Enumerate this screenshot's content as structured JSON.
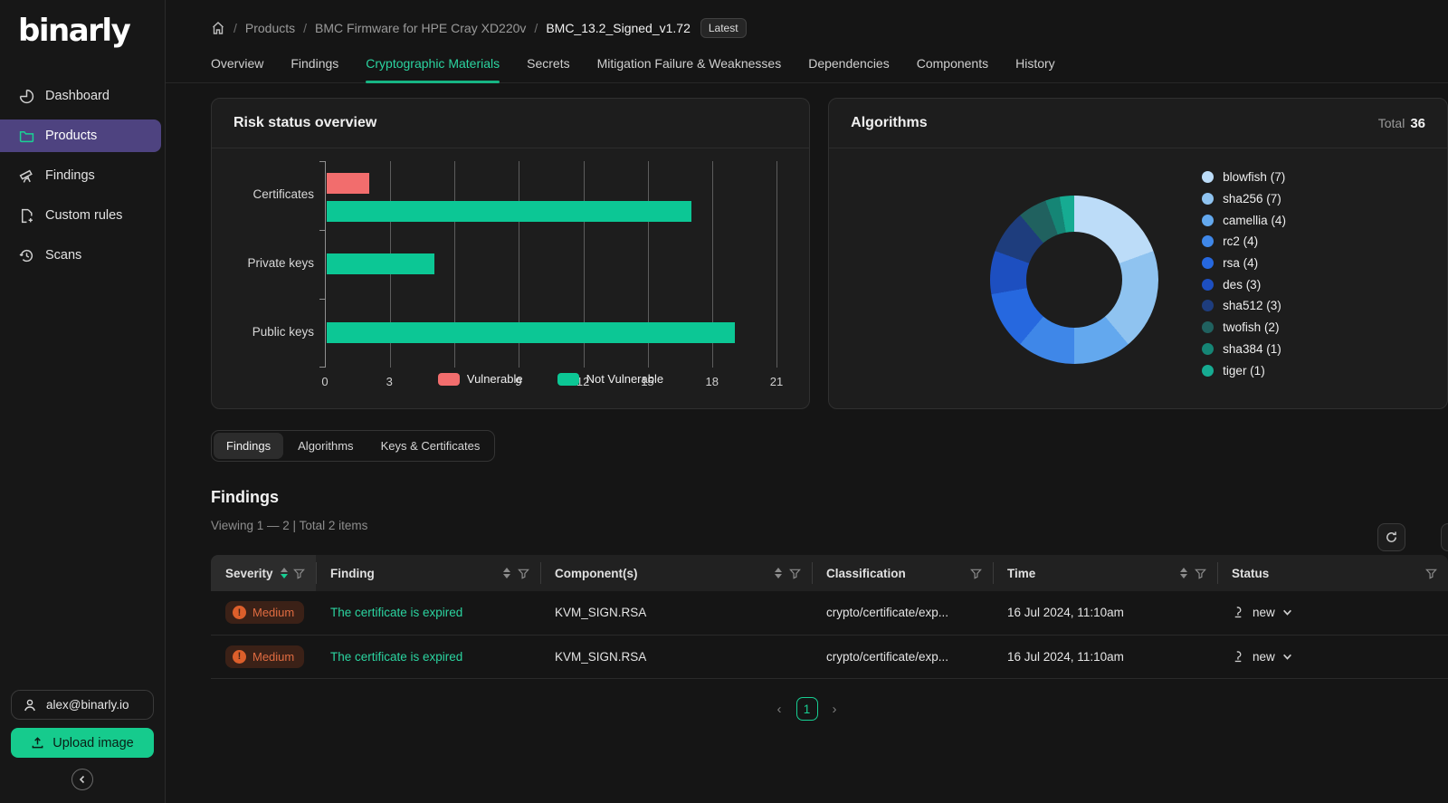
{
  "ui": {
    "logo": "binarly",
    "breadcrumb": {
      "items": [
        "Products",
        "BMC Firmware for HPE Cray XD220v",
        "BMC_13.2_Signed_v1.72"
      ],
      "badge": "Latest"
    },
    "tabs": [
      {
        "label": "Overview"
      },
      {
        "label": "Findings"
      },
      {
        "label": "Cryptographic Materials"
      },
      {
        "label": "Secrets"
      },
      {
        "label": "Mitigation Failure & Weaknesses"
      },
      {
        "label": "Dependencies"
      },
      {
        "label": "Components"
      },
      {
        "label": "History"
      }
    ],
    "subtabs": [
      {
        "label": "Findings"
      },
      {
        "label": "Algorithms"
      },
      {
        "label": "Keys & Certificates"
      }
    ],
    "algorithms_total_label": "Total",
    "algorithms_total_value": "36",
    "findings_title": "Findings",
    "findings_viewing": "Viewing 1 — 2 | Total 2 items",
    "pagination": {
      "page": "1"
    }
  },
  "sidebar": {
    "items": [
      {
        "label": "Dashboard"
      },
      {
        "label": "Products"
      },
      {
        "label": "Findings"
      },
      {
        "label": "Custom rules"
      },
      {
        "label": "Scans"
      }
    ],
    "account": "alex@binarly.io",
    "upload": "Upload image"
  },
  "table": {
    "columns": [
      {
        "label": "Severity"
      },
      {
        "label": "Finding"
      },
      {
        "label": "Component(s)"
      },
      {
        "label": "Classification"
      },
      {
        "label": "Time"
      },
      {
        "label": "Status"
      }
    ],
    "rows": [
      {
        "severity": "Medium",
        "finding": "The certificate is expired",
        "component": "KVM_SIGN.RSA",
        "classification": "crypto/certificate/exp...",
        "time": "16 Jul 2024, 11:10am",
        "status": "new"
      },
      {
        "severity": "Medium",
        "finding": "The certificate is expired",
        "component": "KVM_SIGN.RSA",
        "classification": "crypto/certificate/exp...",
        "time": "16 Jul 2024, 11:10am",
        "status": "new"
      }
    ]
  },
  "chart_data": [
    {
      "type": "bar",
      "orientation": "horizontal",
      "title": "Risk status overview",
      "categories": [
        "Certificates",
        "Private keys",
        "Public keys"
      ],
      "series": [
        {
          "name": "Vulnerable",
          "color": "#f26d6d",
          "values": [
            2,
            0,
            0
          ]
        },
        {
          "name": "Not Vulnerable",
          "color": "#0cc795",
          "values": [
            17,
            5,
            19
          ]
        }
      ],
      "xlim": [
        0,
        21
      ],
      "ticks": [
        0,
        3,
        6,
        9,
        12,
        15,
        18,
        21
      ],
      "grid": true,
      "legend_position": "bottom"
    },
    {
      "type": "pie",
      "subtype": "donut",
      "title": "Algorithms",
      "total": 36,
      "legend_position": "right",
      "slices": [
        {
          "label": "blowfish",
          "value": 7,
          "display": "blowfish (7)",
          "color": "#bcdcf8"
        },
        {
          "label": "sha256",
          "value": 7,
          "display": "sha256 (7)",
          "color": "#8fc3f0"
        },
        {
          "label": "camellia",
          "value": 4,
          "display": "camellia (4)",
          "color": "#63a8ee"
        },
        {
          "label": "rc2",
          "value": 4,
          "display": "rc2 (4)",
          "color": "#3f87e8"
        },
        {
          "label": "rsa",
          "value": 4,
          "display": "rsa (4)",
          "color": "#2668df"
        },
        {
          "label": "des",
          "value": 3,
          "display": "des (3)",
          "color": "#1d4fc0"
        },
        {
          "label": "sha512",
          "value": 3,
          "display": "sha512 (3)",
          "color": "#1e3d7d"
        },
        {
          "label": "twofish",
          "value": 2,
          "display": "twofish (2)",
          "color": "#20615f"
        },
        {
          "label": "sha384",
          "value": 1,
          "display": "sha384 (1)",
          "color": "#158575"
        },
        {
          "label": "tiger",
          "value": 1,
          "display": "tiger (1)",
          "color": "#16ab92"
        }
      ]
    }
  ]
}
